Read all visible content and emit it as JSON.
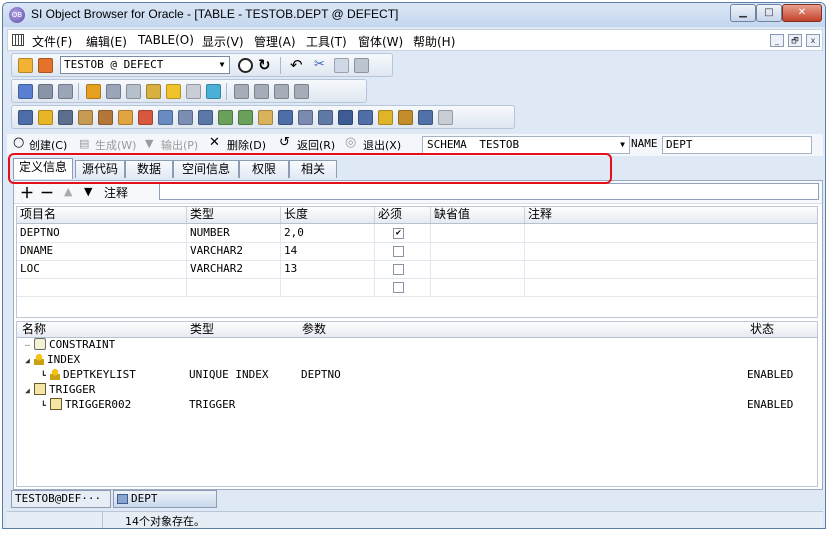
{
  "window": {
    "title": "SI Object Browser for Oracle - [TABLE - TESTOB.DEPT @ DEFECT]",
    "app_icon_text": "OB",
    "controls": {
      "minimize": "▁",
      "maximize": "□",
      "close": "✕"
    }
  },
  "menu": {
    "items": [
      "文件(F)",
      "编辑(E)",
      "TABLE(O)",
      "显示(V)",
      "管理(A)",
      "工具(T)",
      "窗体(W)",
      "帮助(H)"
    ],
    "mdi_controls": [
      "_",
      "🗗",
      "x"
    ]
  },
  "toolbar": {
    "connection_value": "TESTOB @ DEFECT"
  },
  "actions": {
    "create": "创建(C)",
    "generate": "生成(W)",
    "export": "输出(P)",
    "delete": "删除(D)",
    "back": "返回(R)",
    "exit": "退出(X)",
    "schema_label": "SCHEMA",
    "schema_value": "TESTOB",
    "name_label": "NAME",
    "name_value": "DEPT"
  },
  "tabs": [
    "定义信息",
    "源代码",
    "数据",
    "空间信息",
    "权限",
    "相关"
  ],
  "active_tab": "定义信息",
  "column_toolbar": {
    "comment_label": "注释",
    "comment_value": ""
  },
  "columns_grid": {
    "headers": [
      "项目名",
      "类型",
      "长度",
      "必须",
      "缺省值",
      "注释"
    ],
    "rows": [
      {
        "name": "DEPTNO",
        "type": "NUMBER",
        "length": "2,0",
        "required": true,
        "default": "",
        "comment": ""
      },
      {
        "name": "DNAME",
        "type": "VARCHAR2",
        "length": "14",
        "required": false,
        "default": "",
        "comment": ""
      },
      {
        "name": "LOC",
        "type": "VARCHAR2",
        "length": "13",
        "required": false,
        "default": "",
        "comment": ""
      },
      {
        "name": "",
        "type": "",
        "length": "",
        "required": false,
        "default": "",
        "comment": ""
      }
    ]
  },
  "objects_tree": {
    "headers": [
      "名称",
      "类型",
      "参数",
      "状态"
    ],
    "nodes": [
      {
        "name": "CONSTRAINT",
        "type": "",
        "param": "",
        "status": ""
      },
      {
        "name": "INDEX",
        "type": "",
        "param": "",
        "status": ""
      },
      {
        "name": "DEPTKEYLIST",
        "type": "UNIQUE INDEX",
        "param": "DEPTNO",
        "status": "ENABLED"
      },
      {
        "name": "TRIGGER",
        "type": "",
        "param": "",
        "status": ""
      },
      {
        "name": "TRIGGER002",
        "type": "TRIGGER",
        "param": "",
        "status": "ENABLED"
      }
    ]
  },
  "bottom_tabs": [
    "TESTOB@DEF···",
    "DEPT"
  ],
  "status_bar": {
    "message": "14个对象存在。"
  },
  "colors": {
    "highlight_border": "#e3101a",
    "window_frame": "#5a7ea8"
  }
}
